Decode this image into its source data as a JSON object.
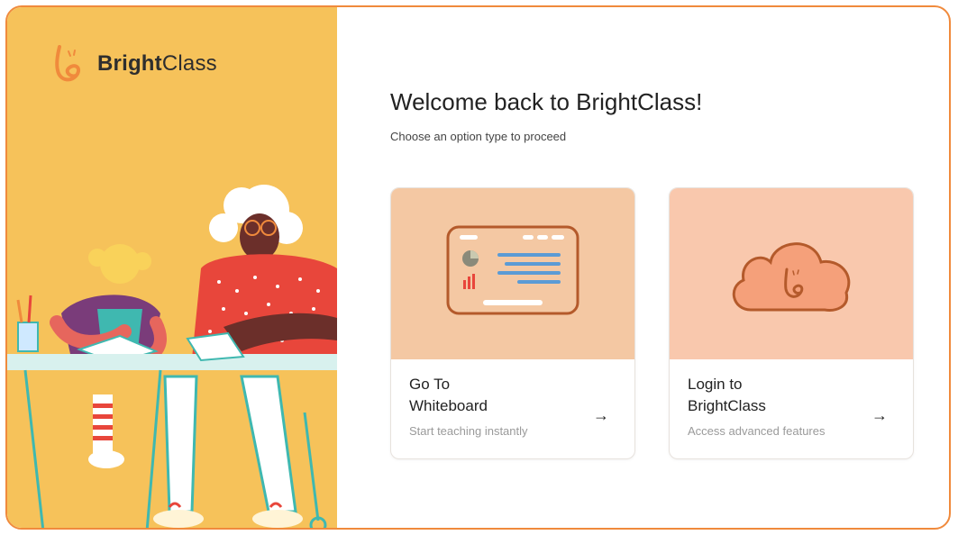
{
  "brand": {
    "bold": "Bright",
    "light": "Class"
  },
  "main": {
    "title": "Welcome back to BrightClass!",
    "subtitle": "Choose an option type to proceed"
  },
  "options": [
    {
      "label_line1": "Go To",
      "label_line2": "Whiteboard",
      "description": "Start teaching instantly",
      "arrow": "→",
      "icon": "whiteboard-icon"
    },
    {
      "label_line1": "Login to",
      "label_line2": "BrightClass",
      "description": "Access advanced features",
      "arrow": "→",
      "icon": "cloud-logo-icon"
    }
  ],
  "colors": {
    "accent": "#f08a3c",
    "left_panel": "#f6c25a",
    "card1_bg": "#f4c8a3",
    "card2_bg": "#f9c8ad"
  }
}
